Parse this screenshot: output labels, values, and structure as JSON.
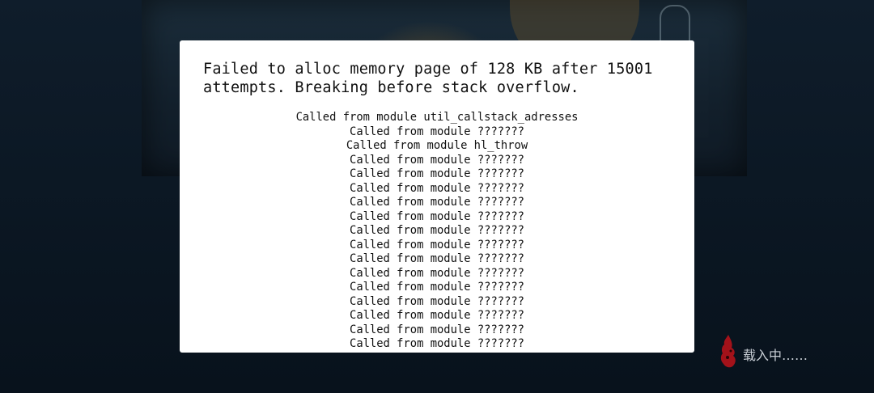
{
  "dialog": {
    "message": "Failed to alloc memory page of 128 KB after 15001\nattempts. Breaking before stack overflow.",
    "stack_trace": [
      "Called from module util_callstack_adresses",
      "Called from module ???????",
      "Called from module hl_throw",
      "Called from module ???????",
      "Called from module ???????",
      "Called from module ???????",
      "Called from module ???????",
      "Called from module ???????",
      "Called from module ???????",
      "Called from module ???????",
      "Called from module ???????",
      "Called from module ???????",
      "Called from module ???????",
      "Called from module ???????",
      "Called from module ???????",
      "Called from module ???????",
      "Called from module ???????"
    ]
  },
  "loading": {
    "text": "载入中……",
    "icon": "flame-icon",
    "icon_color": "#a3121a"
  },
  "colors": {
    "background": "#0b1521",
    "dialog_background": "#ffffff",
    "text": "#111111"
  }
}
